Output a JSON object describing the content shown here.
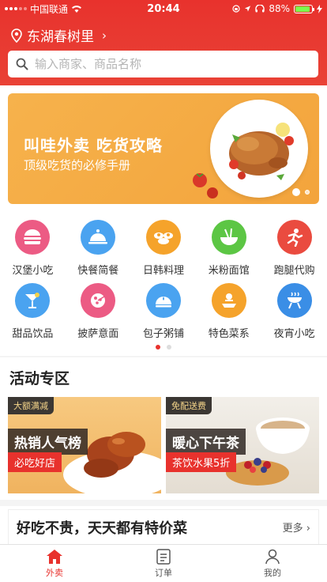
{
  "status_bar": {
    "carrier": "中国联通",
    "time": "20:44",
    "battery": "88%",
    "battery_level": 0.88
  },
  "header": {
    "location": "东湖春树里",
    "search_placeholder": "输入商家、商品名称"
  },
  "banner": {
    "title": "叫哇外卖  吃货攻略",
    "subtitle": "顶级吃货的必修手册",
    "page_count": 2,
    "active_page": 1
  },
  "categories": [
    {
      "label": "汉堡小吃",
      "icon": "burger-icon",
      "color": "#ec5b84"
    },
    {
      "label": "快餐简餐",
      "icon": "cloche-icon",
      "color": "#4aa3f0"
    },
    {
      "label": "日韩料理",
      "icon": "sushi-icon",
      "color": "#f5a32b"
    },
    {
      "label": "米粉面馆",
      "icon": "noodle-icon",
      "color": "#5cc644"
    },
    {
      "label": "跑腿代购",
      "icon": "runner-icon",
      "color": "#ea4b3f"
    },
    {
      "label": "甜品饮品",
      "icon": "cocktail-icon",
      "color": "#4aa3f0"
    },
    {
      "label": "披萨意面",
      "icon": "pizza-icon",
      "color": "#ec5b84"
    },
    {
      "label": "包子粥铺",
      "icon": "bun-icon",
      "color": "#4aa3f0"
    },
    {
      "label": "特色菜系",
      "icon": "dish-icon",
      "color": "#f5a32b"
    },
    {
      "label": "夜宵小吃",
      "icon": "grill-icon",
      "color": "#3a8ee6"
    }
  ],
  "category_pages": {
    "count": 2,
    "active": 1
  },
  "activity": {
    "title": "活动专区",
    "cards": [
      {
        "tag": "大额满减",
        "title": "热销人气榜",
        "subtitle": "必吃好店"
      },
      {
        "tag": "免配送费",
        "title": "暖心下午茶",
        "subtitle": "茶饮水果5折"
      }
    ]
  },
  "bargain": {
    "title": "好吃不贵，天天都有特价菜",
    "more": "更多"
  },
  "tabbar": [
    {
      "label": "外卖",
      "icon": "home-icon",
      "active": true
    },
    {
      "label": "订单",
      "icon": "order-icon",
      "active": false
    },
    {
      "label": "我的",
      "icon": "user-icon",
      "active": false
    }
  ],
  "colors": {
    "brand": "#e8322d",
    "banner": "#f4a93f"
  }
}
